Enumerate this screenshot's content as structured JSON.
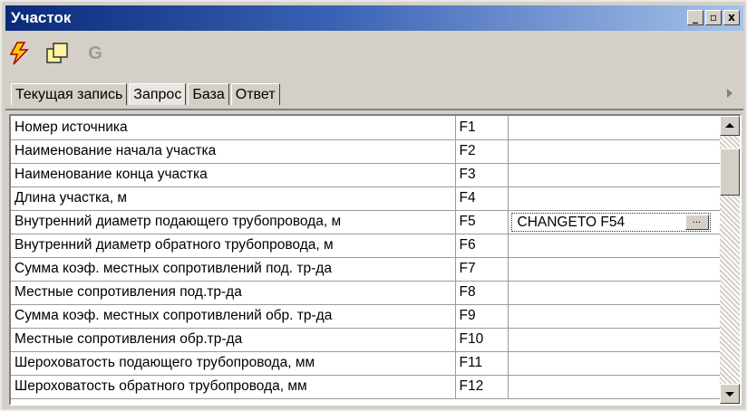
{
  "window": {
    "title": "Участок",
    "buttons": [
      "_",
      "▫",
      "x"
    ]
  },
  "toolbar": {
    "icons": [
      "lightning-icon",
      "new-document-icon",
      "g-icon"
    ],
    "g_label": "G"
  },
  "tabs": [
    {
      "label": "Текущая запись",
      "active": false
    },
    {
      "label": "Запрос",
      "active": true
    },
    {
      "label": "База",
      "active": false
    },
    {
      "label": "Ответ",
      "active": false
    }
  ],
  "grid": {
    "rows": [
      {
        "name": "Номер источника",
        "field": "F1",
        "value": ""
      },
      {
        "name": "Наименование начала участка",
        "field": "F2",
        "value": ""
      },
      {
        "name": "Наименование конца участка",
        "field": "F3",
        "value": ""
      },
      {
        "name": "Длина участка, м",
        "field": "F4",
        "value": ""
      },
      {
        "name": "Внутренний диаметр подающего трубопровода, м",
        "field": "F5",
        "value": "CHANGETO F54"
      },
      {
        "name": "Внутренний диаметр обратного трубопровода, м",
        "field": "F6",
        "value": ""
      },
      {
        "name": "Сумма коэф. местных сопротивлений под. тр-да",
        "field": "F7",
        "value": ""
      },
      {
        "name": "Местные сопротивления под.тр-да",
        "field": "F8",
        "value": ""
      },
      {
        "name": "Сумма коэф. местных сопротивлений обр. тр-да",
        "field": "F9",
        "value": ""
      },
      {
        "name": "Местные сопротивления обр.тр-да",
        "field": "F10",
        "value": ""
      },
      {
        "name": "Шероховатость подающего трубопровода, мм",
        "field": "F11",
        "value": ""
      },
      {
        "name": "Шероховатость обратного трубопровода, мм",
        "field": "F12",
        "value": ""
      }
    ],
    "ellipsis_label": "..."
  }
}
